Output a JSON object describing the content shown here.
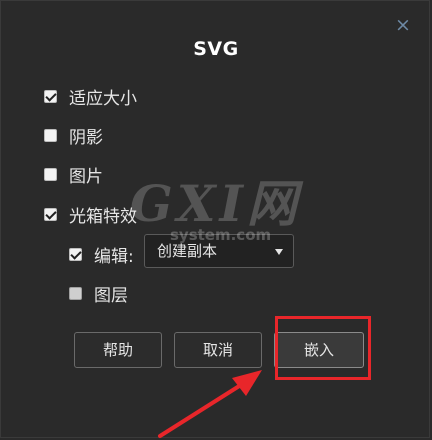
{
  "dialog": {
    "title": "SVG",
    "close_symbol": "×"
  },
  "options": [
    {
      "label": "适应大小",
      "checked": true
    },
    {
      "label": "阴影",
      "checked": false
    },
    {
      "label": "图片",
      "checked": false
    },
    {
      "label": "光箱特效",
      "checked": true
    }
  ],
  "sub_options": {
    "edit_label": "编辑:",
    "edit_checked": true,
    "edit_select_value": "创建副本",
    "layer_label": "图层",
    "layer_checked": false
  },
  "buttons": {
    "help": "帮助",
    "cancel": "取消",
    "embed": "嵌入"
  },
  "watermark": {
    "big": "GXI网",
    "small": "system.com"
  },
  "annotation_colors": {
    "highlight": "#e8262a"
  }
}
